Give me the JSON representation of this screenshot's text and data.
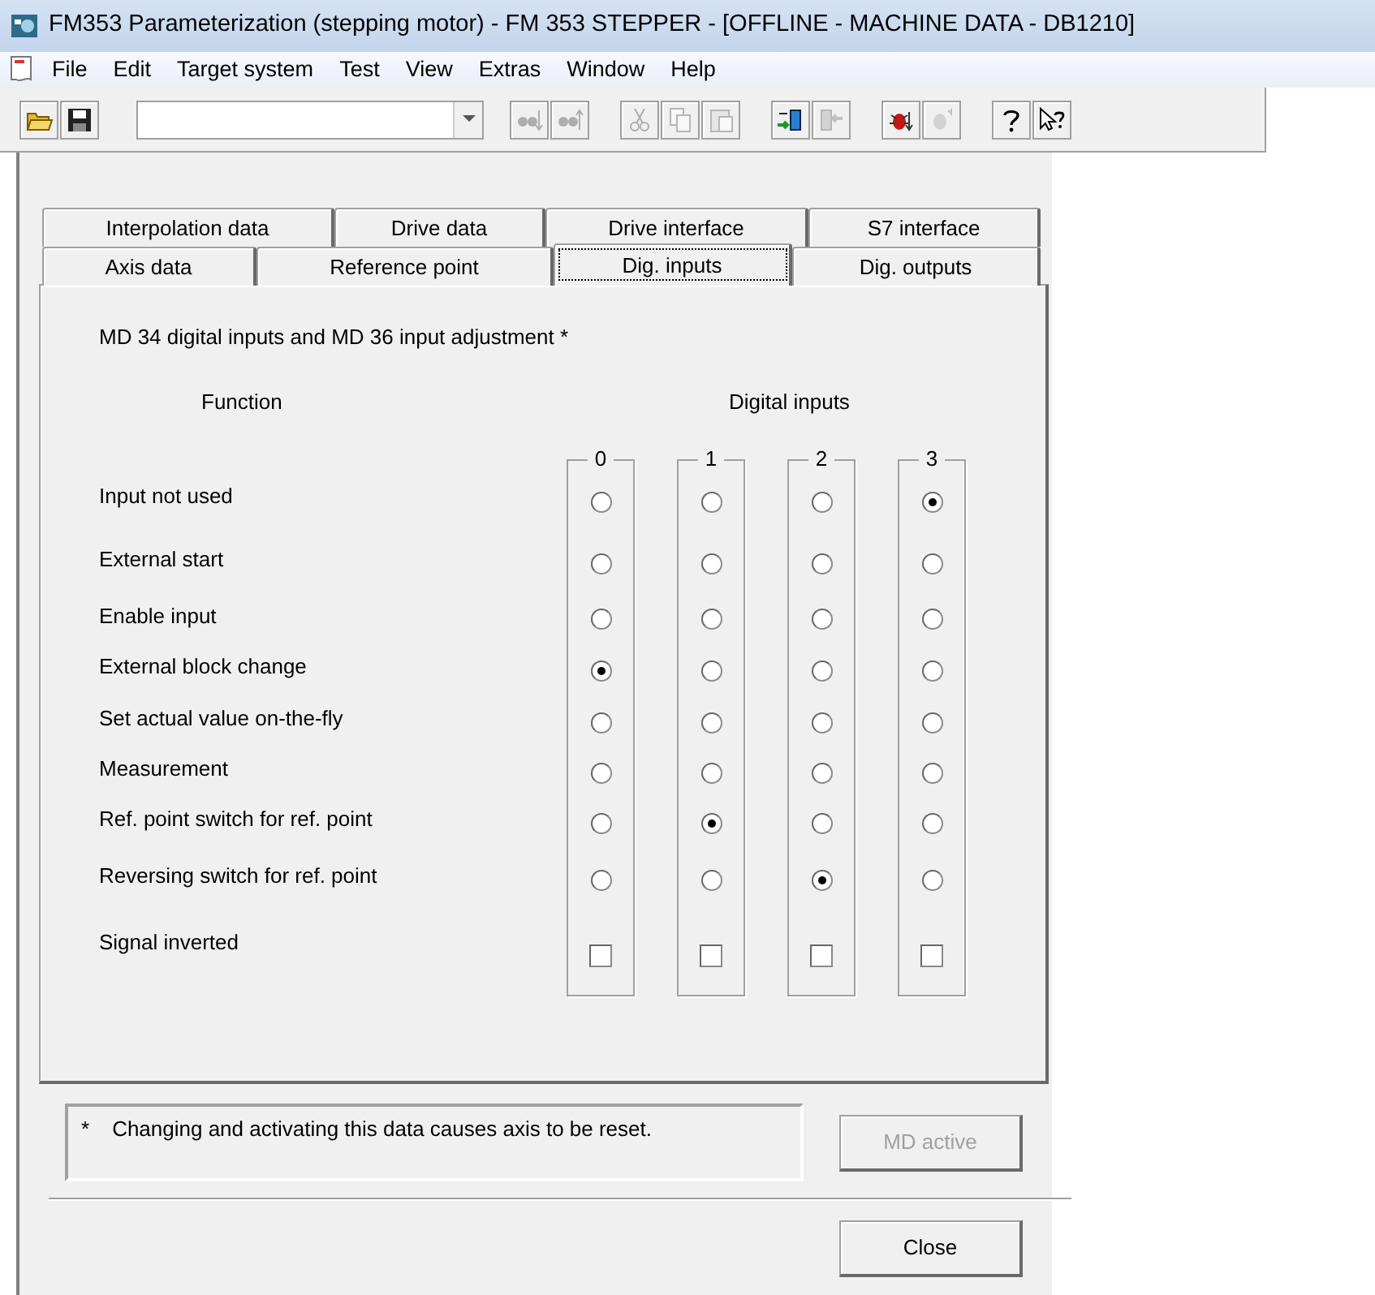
{
  "window": {
    "title": "FM353 Parameterization (stepping motor) - FM 353 STEPPER - [OFFLINE - MACHINE DATA - DB1210]"
  },
  "menu": [
    "File",
    "Edit",
    "Target system",
    "Test",
    "View",
    "Extras",
    "Window",
    "Help"
  ],
  "toolbar": {
    "buttons": [
      {
        "disabled": false
      },
      {
        "disabled": false
      },
      {
        "disabled": true
      },
      {
        "disabled": true
      },
      {
        "disabled": true
      },
      {
        "disabled": true
      },
      {
        "disabled": true
      },
      {
        "disabled": false
      },
      {
        "disabled": true
      },
      {
        "disabled": false
      },
      {
        "disabled": true
      },
      {
        "disabled": false
      },
      {
        "disabled": false
      }
    ]
  },
  "tabs": [
    [
      {
        "label": "Interpolation data",
        "selected": false
      },
      {
        "label": "Drive data",
        "selected": false
      },
      {
        "label": "Drive interface",
        "selected": false
      },
      {
        "label": "S7 interface",
        "selected": false
      }
    ],
    [
      {
        "label": "Axis data",
        "selected": false
      },
      {
        "label": "Reference point",
        "selected": false
      },
      {
        "label": "Dig. inputs",
        "selected": true
      },
      {
        "label": "Dig. outputs",
        "selected": false
      }
    ]
  ],
  "heading": "MD 34 digital inputs and MD 36 input adjustment *",
  "function_label": "Function",
  "inputs_label": "Digital inputs",
  "columns": [
    "0",
    "1",
    "2",
    "3"
  ],
  "rows": [
    {
      "label": "Input not used",
      "kind": "radio",
      "cells": [
        {
          "selected": false
        },
        {
          "selected": false
        },
        {
          "selected": false
        },
        {
          "selected": true
        }
      ]
    },
    {
      "label": "External start",
      "kind": "radio",
      "cells": [
        {
          "selected": false
        },
        {
          "selected": false
        },
        {
          "selected": false
        },
        {
          "selected": false
        }
      ]
    },
    {
      "label": "Enable input",
      "kind": "radio",
      "cells": [
        {
          "selected": false
        },
        {
          "selected": false
        },
        {
          "selected": false
        },
        {
          "selected": false
        }
      ]
    },
    {
      "label": "External block change",
      "kind": "radio",
      "cells": [
        {
          "selected": true
        },
        {
          "selected": false
        },
        {
          "selected": false
        },
        {
          "selected": false
        }
      ]
    },
    {
      "label": "Set actual value on-the-fly",
      "kind": "radio",
      "cells": [
        {
          "selected": false
        },
        {
          "selected": false
        },
        {
          "selected": false
        },
        {
          "selected": false
        }
      ]
    },
    {
      "label": "Measurement",
      "kind": "radio",
      "cells": [
        {
          "selected": false
        },
        {
          "selected": false
        },
        {
          "selected": false
        },
        {
          "selected": false
        }
      ]
    },
    {
      "label": "Ref. point switch for ref. point",
      "kind": "radio",
      "cells": [
        {
          "selected": false
        },
        {
          "selected": true
        },
        {
          "selected": false
        },
        {
          "selected": false
        }
      ]
    },
    {
      "label": "Reversing switch for ref. point",
      "kind": "radio",
      "cells": [
        {
          "selected": false
        },
        {
          "selected": false
        },
        {
          "selected": true
        },
        {
          "selected": false
        }
      ]
    },
    {
      "label": "Signal inverted",
      "kind": "checkbox",
      "cells": [
        {
          "checked": false
        },
        {
          "checked": false
        },
        {
          "checked": false
        },
        {
          "checked": false
        }
      ]
    }
  ],
  "note": {
    "mark": "*",
    "text": "Changing and activating this data causes axis to be reset."
  },
  "buttons": [
    {
      "label": "MD active",
      "disabled": true
    },
    {
      "label": "Close",
      "disabled": false
    }
  ]
}
